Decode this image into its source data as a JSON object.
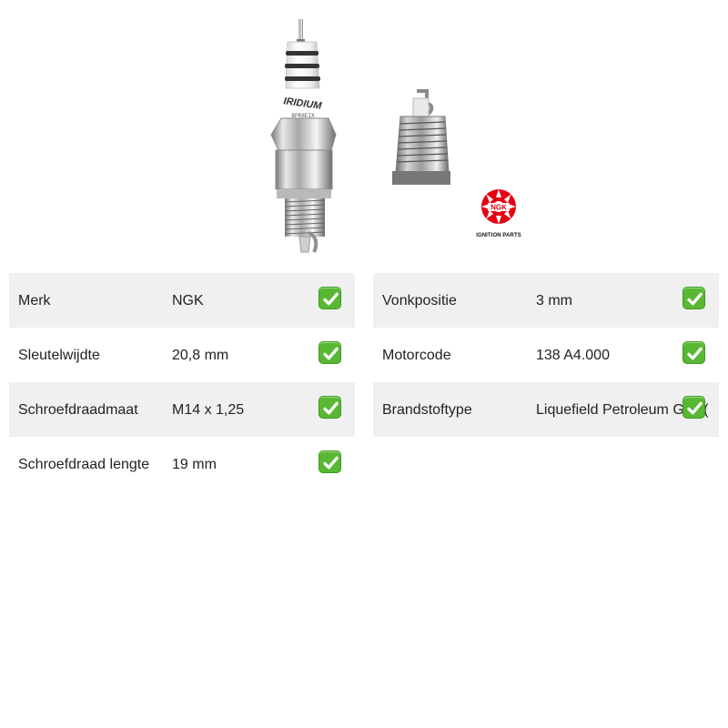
{
  "product": {
    "brand_logo_text": "NGK",
    "brand_tagline": "IGNITION PARTS",
    "plug_marking_main": "IRIDIUM",
    "plug_marking_sub": "BPR8EIX"
  },
  "specs": {
    "left": [
      {
        "label": "Merk",
        "value": "NGK",
        "icon": "check-mark-icon",
        "shaded": true
      },
      {
        "label": "Sleutelwijdte",
        "value": "20,8 mm",
        "icon": "check-mark-icon",
        "shaded": false
      },
      {
        "label": "Schroefdraadmaat",
        "value": "M14 x 1,25",
        "icon": "check-mark-icon",
        "shaded": true
      },
      {
        "label": "Schroefdraad lengte",
        "value": "19 mm",
        "icon": "check-mark-icon",
        "shaded": false
      }
    ],
    "right": [
      {
        "label": "Vonkpositie",
        "value": "3 mm",
        "icon": "check-mark-icon",
        "shaded": true
      },
      {
        "label": "Motorcode",
        "value": "138 A4.000",
        "icon": "check-mark-icon",
        "shaded": false
      },
      {
        "label": "Brandstoftype",
        "value": "Liquefield Petroleum Gas (",
        "icon": "check-mark-icon",
        "shaded": true
      }
    ]
  },
  "colors": {
    "row_shade": "#f0f0f0",
    "check_green": "#59b833",
    "ngk_red": "#e60012"
  }
}
